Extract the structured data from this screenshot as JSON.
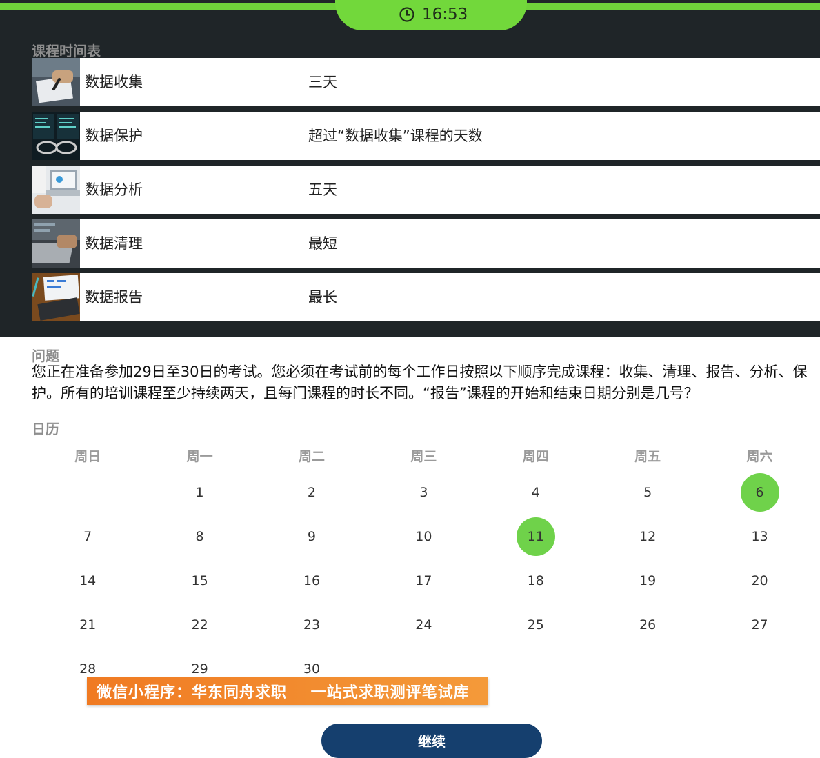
{
  "timer": {
    "time": "16:53",
    "icon": "clock-icon"
  },
  "schedule": {
    "title": "课程时间表",
    "courses": [
      {
        "name": "数据收集",
        "duration": "三天",
        "thumb": "writing-notes-image"
      },
      {
        "name": "数据保护",
        "duration": "超过“数据收集”课程的天数",
        "thumb": "code-screens-image"
      },
      {
        "name": "数据分析",
        "duration": "五天",
        "thumb": "laptop-work-image"
      },
      {
        "name": "数据清理",
        "duration": "最短",
        "thumb": "laptop-typing-image"
      },
      {
        "name": "数据报告",
        "duration": "最长",
        "thumb": "report-desk-image"
      }
    ]
  },
  "question": {
    "title": "问题",
    "text": "您正在准备参加29日至30日的考试。您必须在考试前的每个工作日按照以下顺序完成课程：收集、清理、报告、分析、保护。所有的培训课程至少持续两天，且每门课程的时长不同。“报告”课程的开始和结束日期分别是几号？"
  },
  "calendar": {
    "title": "日历",
    "weekdays": [
      "周日",
      "周一",
      "周二",
      "周三",
      "周四",
      "周五",
      "周六"
    ],
    "weeks": [
      [
        "",
        "1",
        "2",
        "3",
        "4",
        "5",
        "6"
      ],
      [
        "7",
        "8",
        "9",
        "10",
        "11",
        "12",
        "13"
      ],
      [
        "14",
        "15",
        "16",
        "17",
        "18",
        "19",
        "20"
      ],
      [
        "21",
        "22",
        "23",
        "24",
        "25",
        "26",
        "27"
      ],
      [
        "28",
        "29",
        "30",
        "",
        "",
        "",
        ""
      ]
    ],
    "highlighted": [
      "6",
      "11"
    ],
    "highlight_color": "#6fd24a"
  },
  "banner": {
    "text": "微信小程序：华东同舟求职    一站式求职测评笔试库"
  },
  "continue_button": {
    "label": "继续"
  },
  "colors": {
    "accent": "#72d83b",
    "panel": "#1f2528",
    "button": "#153f6e",
    "banner": "#f07a22"
  }
}
